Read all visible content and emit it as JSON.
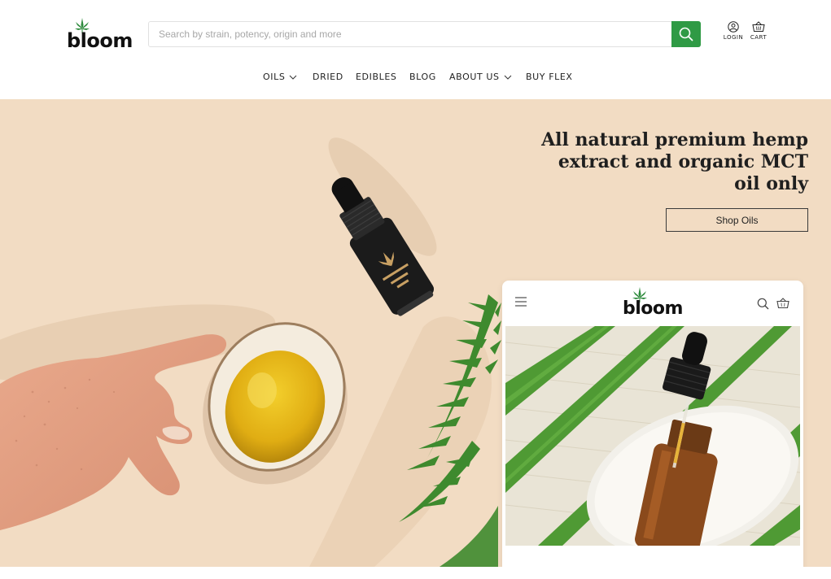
{
  "brand": {
    "name": "bloom"
  },
  "search": {
    "placeholder": "Search by strain, potency, origin and more",
    "value": ""
  },
  "account": {
    "login_label": "LOGIN",
    "cart_label": "CART"
  },
  "nav": {
    "items": [
      {
        "label": "OILS",
        "has_dropdown": true
      },
      {
        "label": "DRIED",
        "has_dropdown": false
      },
      {
        "label": "EDIBLES",
        "has_dropdown": false
      },
      {
        "label": "BLOG",
        "has_dropdown": false
      },
      {
        "label": "ABOUT US",
        "has_dropdown": true
      },
      {
        "label": "BUY FLEX",
        "has_dropdown": false
      }
    ]
  },
  "hero": {
    "headline": "All natural premium hemp extract and organic MCT oil only",
    "cta_label": "Shop Oils"
  },
  "phone": {
    "brand": "bloom"
  },
  "colors": {
    "accent_green": "#2f9a45",
    "hero_bg": "#f2dcc3",
    "text_dark": "#1f1f1f"
  },
  "icons": [
    "leaf-icon",
    "search-icon",
    "user-icon",
    "cart-icon",
    "chevron-down-icon",
    "menu-icon"
  ]
}
